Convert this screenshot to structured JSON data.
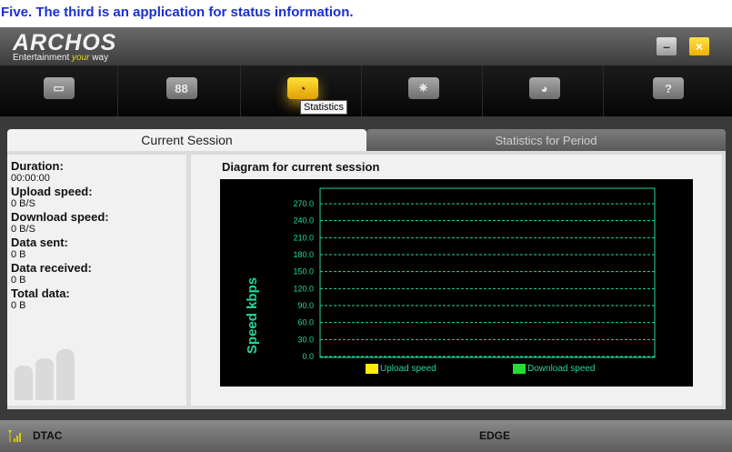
{
  "caption": "Five. The third is an application for status information.",
  "app": {
    "logo": {
      "main": "ARCHOS",
      "tag_left": "Entertainment",
      "tag_mid": "your",
      "tag_right": "way"
    },
    "window_buttons": {
      "minimize": "–",
      "close": "×"
    },
    "toolbar": {
      "items": [
        {
          "icon": "monitor-icon",
          "glyph": "▭"
        },
        {
          "icon": "grid-icon",
          "glyph": "88"
        },
        {
          "icon": "statistics-icon",
          "glyph": "◔"
        },
        {
          "icon": "settings-gear-icon",
          "glyph": "✷"
        },
        {
          "icon": "globe-icon",
          "glyph": "◕"
        },
        {
          "icon": "help-icon",
          "glyph": "?"
        }
      ],
      "active_index": 2,
      "tooltip": "Statistics"
    },
    "tabs": {
      "current": "Current Session",
      "period": "Statistics for Period"
    },
    "stats": [
      {
        "label": "Duration:",
        "value": "00:00:00"
      },
      {
        "label": "Upload speed:",
        "value": "0 B/S"
      },
      {
        "label": "Download speed:",
        "value": "0 B/S"
      },
      {
        "label": "Data sent:",
        "value": "0 B"
      },
      {
        "label": "Data received:",
        "value": "0 B"
      },
      {
        "label": "Total data:",
        "value": "0 B"
      }
    ],
    "diagram_title": "Diagram for current session",
    "chart_data": {
      "type": "line",
      "ylabel": "Speed kbps",
      "yticks": [
        "270.0",
        "240.0",
        "210.0",
        "180.0",
        "150.0",
        "120.0",
        "90.0",
        "60.0",
        "30.0",
        "0.0"
      ],
      "ylim": [
        0,
        270
      ],
      "grid": true,
      "series": [
        {
          "name": "Upload speed",
          "color": "#ffee00",
          "values": []
        },
        {
          "name": "Download speed",
          "color": "#22dd33",
          "values": []
        }
      ]
    },
    "status": {
      "carrier": "DTAC",
      "network": "EDGE"
    },
    "colors": {
      "accent": "#f0b000",
      "chart_line": "#20d8a0"
    }
  }
}
